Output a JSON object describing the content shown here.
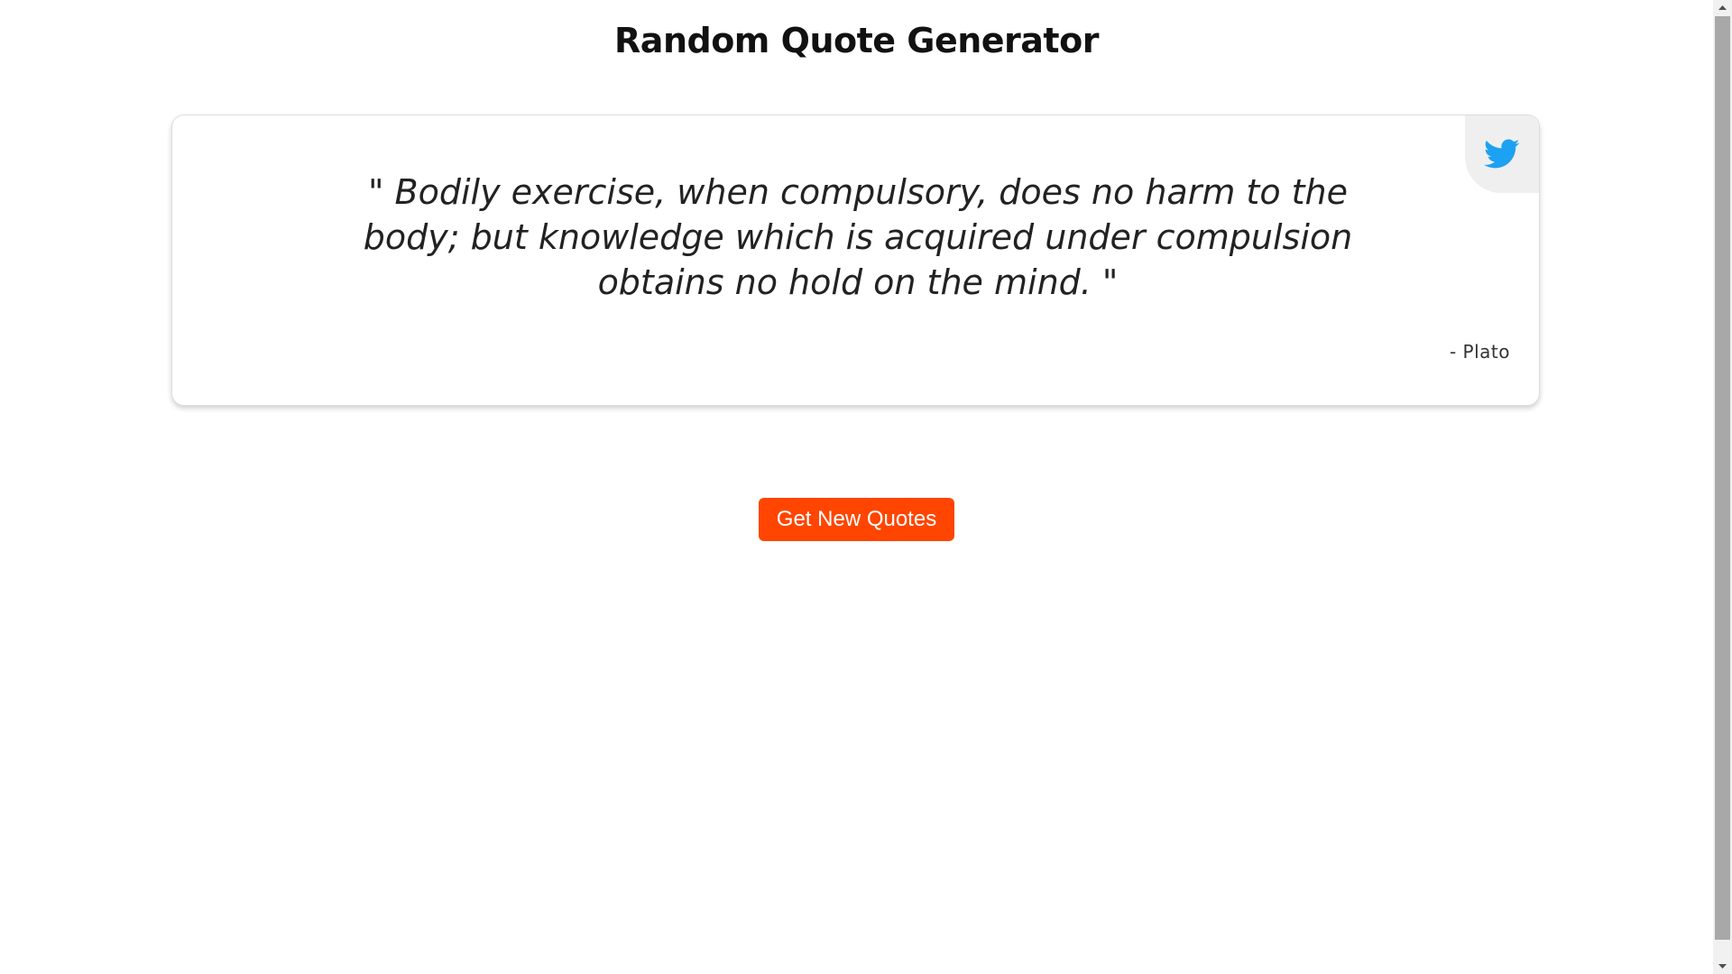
{
  "header": {
    "title": "Random Quote Generator"
  },
  "quote_card": {
    "text": "\" Bodily exercise, when compulsory, does no harm to the body; but knowledge which is acquired under compulsion obtains no hold on the mind. \"",
    "author": "- Plato",
    "tweet_icon": "twitter-icon"
  },
  "actions": {
    "new_quote_label": "Get New Quotes"
  },
  "colors": {
    "accent": "#ff4500",
    "twitter_blue": "#1da1f2",
    "tweet_button_bg": "#efefef"
  },
  "scrollbar": {
    "up_icon": "arrow-up-icon",
    "down_icon": "arrow-down-icon"
  }
}
